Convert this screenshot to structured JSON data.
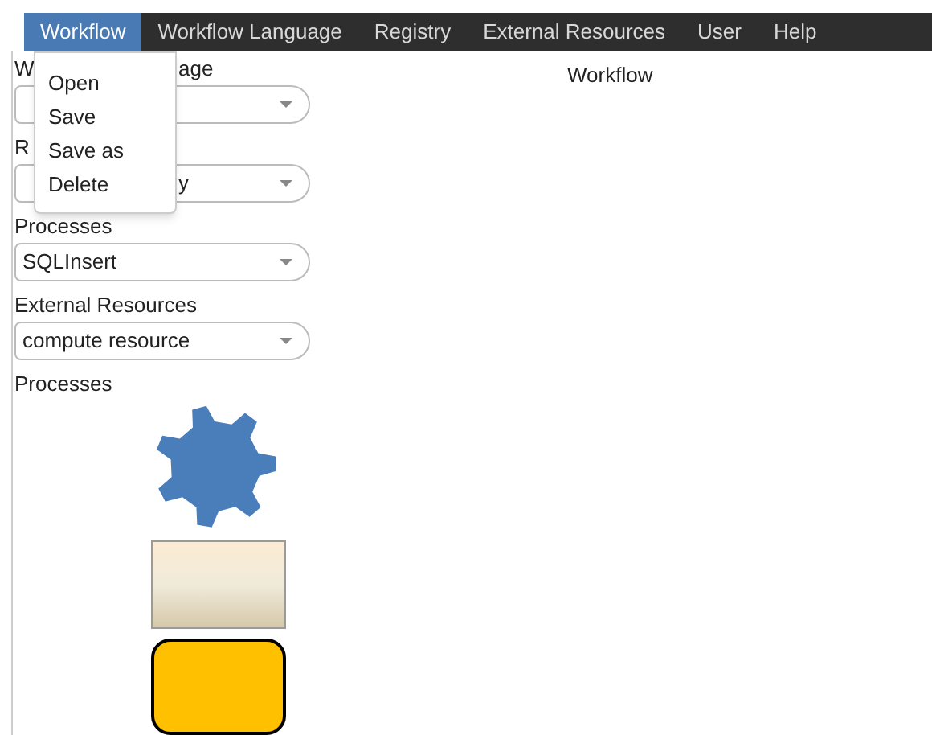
{
  "menu_bar": [
    {
      "label": "Workflow",
      "selected": true
    },
    {
      "label": "Workflow Language",
      "selected": false
    },
    {
      "label": "Registry",
      "selected": false
    },
    {
      "label": "External Resources",
      "selected": false
    },
    {
      "label": "User",
      "selected": false
    },
    {
      "label": "Help",
      "selected": false
    }
  ],
  "menu": {
    "items": [
      "Open",
      "Save",
      "Save as",
      "Delete"
    ]
  },
  "sidebar": {
    "fields": [
      {
        "label": "W",
        "label_tail": "age"
      },
      {
        "label": "R",
        "value_tail": "y"
      },
      {
        "label": "Processes",
        "value": "SQLInsert"
      },
      {
        "label": "External Resources",
        "value": "compute resource"
      }
    ],
    "palette_title": "Processes",
    "palette": [
      {
        "kind": "gear"
      },
      {
        "kind": "task"
      },
      {
        "kind": "terminal"
      }
    ]
  },
  "canvas": {
    "title": "Workflow"
  }
}
